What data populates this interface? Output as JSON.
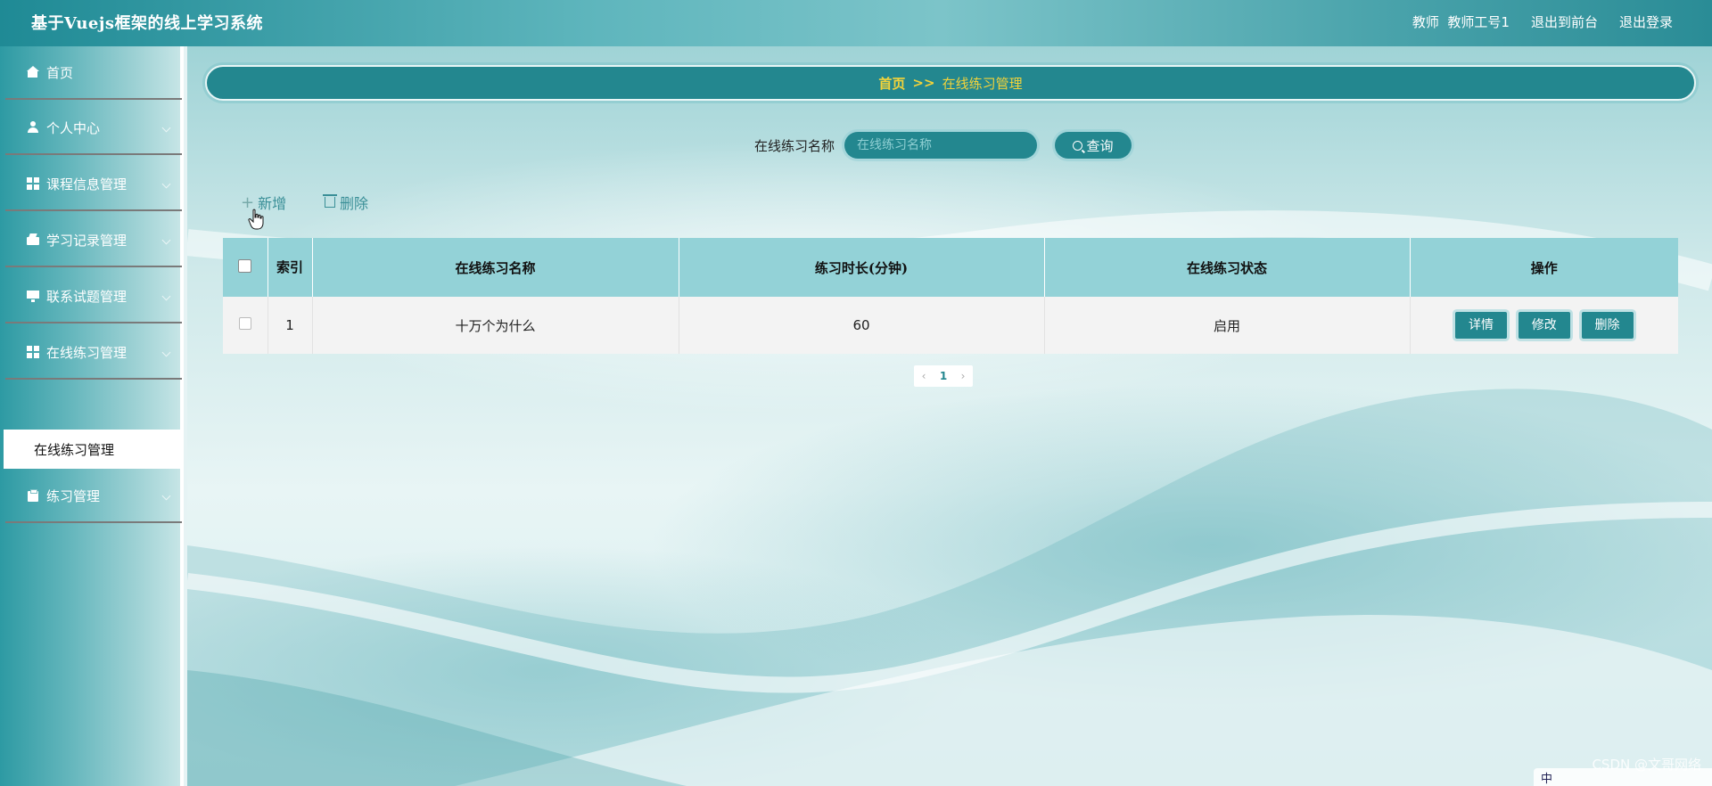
{
  "header": {
    "app_title": "基于Vuejs框架的线上学习系统",
    "role_user": "教师  教师工号1",
    "back_to_front": "退出到前台",
    "logout": "退出登录"
  },
  "sidebar": {
    "items": [
      {
        "label": "首页",
        "icon": "home-icon"
      },
      {
        "label": "个人中心",
        "icon": "user-icon"
      },
      {
        "label": "课程信息管理",
        "icon": "grid-icon"
      },
      {
        "label": "学习记录管理",
        "icon": "book-icon"
      },
      {
        "label": "联系试题管理",
        "icon": "monitor-icon"
      },
      {
        "label": "在线练习管理",
        "icon": "grid-icon"
      },
      {
        "label": "练习管理",
        "icon": "clipboard-icon"
      }
    ],
    "active_sub": "在线练习管理"
  },
  "breadcrumb": {
    "home": "首页",
    "separator": ">>",
    "current": "在线练习管理"
  },
  "search": {
    "label": "在线练习名称",
    "placeholder": "在线练习名称",
    "value": "",
    "button": "查询"
  },
  "actions": {
    "add": "新增",
    "delete": "删除"
  },
  "table": {
    "headers": {
      "index": "索引",
      "name": "在线练习名称",
      "duration": "练习时长(分钟)",
      "status": "在线练习状态",
      "ops": "操作"
    },
    "rows": [
      {
        "index": "1",
        "name": "十万个为什么",
        "duration": "60",
        "status": "启用"
      }
    ],
    "row_actions": {
      "detail": "详情",
      "edit": "修改",
      "delete": "删除"
    }
  },
  "pagination": {
    "prev": "‹",
    "current": "1",
    "next": "›"
  },
  "watermark": "CSDN @文哥网络",
  "tray": {
    "ime": "中"
  },
  "colors": {
    "primary": "#23878f",
    "accent": "#f3d33a",
    "table_header": "#93d2d7"
  }
}
